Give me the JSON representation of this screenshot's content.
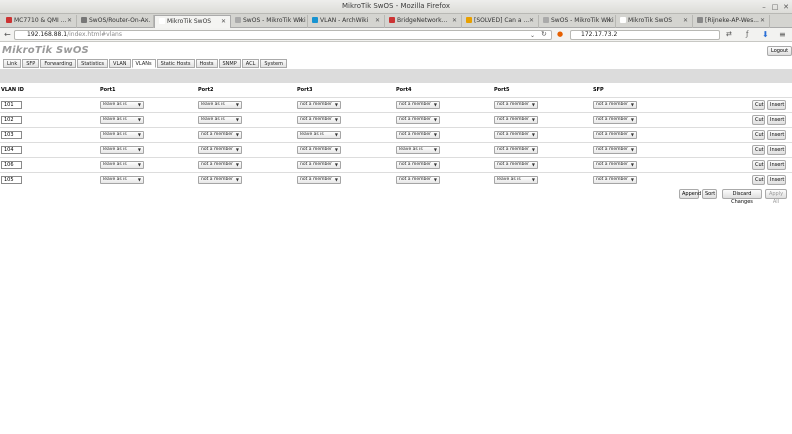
{
  "window": {
    "title": "MikroTik SwOS - Mozilla Firefox"
  },
  "tabs": [
    {
      "label": "MC7710 & QMI ...",
      "active": false,
      "color": "#c33"
    },
    {
      "label": "SwOS/Router-On-A...",
      "active": false,
      "color": "#777"
    },
    {
      "label": "MikroTik SwOS",
      "active": true,
      "color": "#fff"
    },
    {
      "label": "SwOS - MikroTik Wiki",
      "active": false,
      "color": "#aaa"
    },
    {
      "label": "VLAN - ArchWiki",
      "active": false,
      "color": "#1793d1"
    },
    {
      "label": "BridgeNetwork...",
      "active": false,
      "color": "#c33"
    },
    {
      "label": "[SOLVED] Can a ...",
      "active": false,
      "color": "#e8a000"
    },
    {
      "label": "SwOS - MikroTik Wiki",
      "active": false,
      "color": "#aaa"
    },
    {
      "label": "MikroTik SwOS",
      "active": false,
      "color": "#fff"
    },
    {
      "label": "[Rijneke-AP-Wes...",
      "active": false,
      "color": "#888"
    }
  ],
  "nav": {
    "url_host": "192.168.88.1",
    "url_path": "/index.html#vlans",
    "search_value": "172.17.73.2"
  },
  "app": {
    "logo": "MikroTik SwOS",
    "logout_label": "Logout",
    "menu": [
      "Link",
      "SFP",
      "Forwarding",
      "Statistics",
      "VLAN",
      "VLANs",
      "Static Hosts",
      "Hosts",
      "SNMP",
      "ACL",
      "System"
    ],
    "active_menu": "VLANs"
  },
  "table": {
    "headers": [
      "VLAN ID",
      "Port1",
      "Port2",
      "Port3",
      "Port4",
      "Port5",
      "SFP"
    ],
    "rows": [
      {
        "id": "101",
        "ports": [
          "leave as is",
          "leave as is",
          "not a member",
          "not a member",
          "not a member",
          "not a member"
        ]
      },
      {
        "id": "102",
        "ports": [
          "leave as is",
          "leave as is",
          "not a member",
          "not a member",
          "not a member",
          "not a member"
        ]
      },
      {
        "id": "103",
        "ports": [
          "leave as is",
          "not a member",
          "leave as is",
          "not a member",
          "not a member",
          "not a member"
        ]
      },
      {
        "id": "104",
        "ports": [
          "leave as is",
          "not a member",
          "not a member",
          "leave as is",
          "not a member",
          "not a member"
        ]
      },
      {
        "id": "106",
        "ports": [
          "leave as is",
          "not a member",
          "not a member",
          "not a member",
          "not a member",
          "not a member"
        ]
      },
      {
        "id": "105",
        "ports": [
          "leave as is",
          "not a member",
          "not a member",
          "not a member",
          "leave as is",
          "not a member"
        ]
      }
    ],
    "cut_label": "Cut",
    "insert_label": "Insert"
  },
  "actions": {
    "append": "Append",
    "sort": "Sort",
    "discard": "Discard Changes",
    "apply": "Apply All"
  }
}
